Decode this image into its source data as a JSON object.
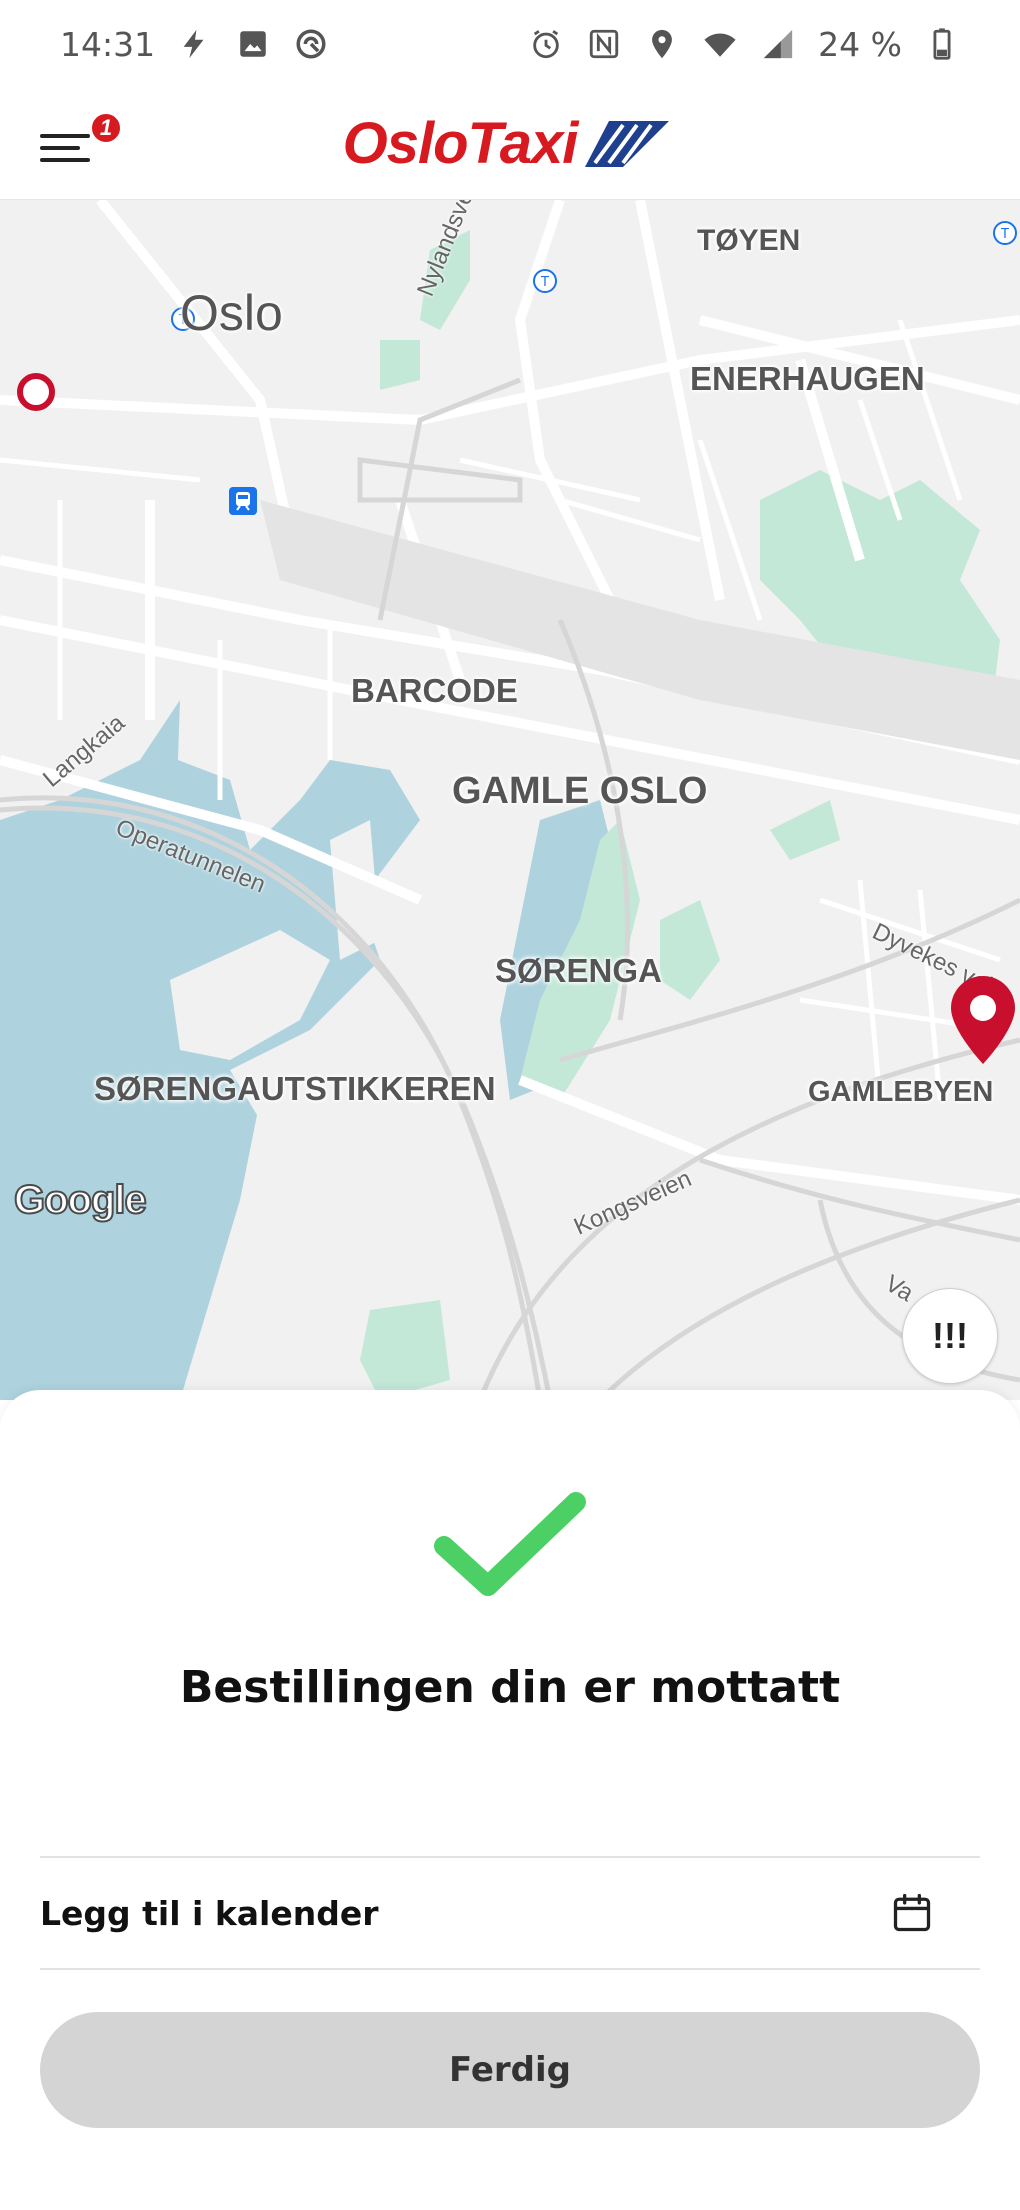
{
  "status_bar": {
    "time": "14:31",
    "left_icons": [
      "flash-icon",
      "image-icon",
      "sync-icon"
    ],
    "right_icons": [
      "alarm-icon",
      "nfc-icon",
      "location-icon",
      "wifi-icon",
      "signal-icon",
      "battery-icon"
    ],
    "battery": "24 %"
  },
  "header": {
    "menu_badge": "1",
    "logo_text": "OsloTaxi",
    "brand_color": "#d71920"
  },
  "map": {
    "city_label": "Oslo",
    "districts": [
      {
        "name": "TØYEN"
      },
      {
        "name": "ENERHAUGEN"
      },
      {
        "name": "BARCODE"
      },
      {
        "name": "GAMLE OSLO"
      },
      {
        "name": "SØRENGA"
      },
      {
        "name": "SØRENGAUTSTIKKEREN"
      },
      {
        "name": "GAMLEBYEN"
      }
    ],
    "streets": [
      {
        "name": "Nylandsveien"
      },
      {
        "name": "Langkaia"
      },
      {
        "name": "Operatunnelen"
      },
      {
        "name": "Dyvekes vei"
      },
      {
        "name": "Kongsveien"
      },
      {
        "name": "Va"
      }
    ],
    "attribution": "Google",
    "alert_button": "!!!",
    "colors": {
      "water": "#aed3de",
      "park": "#c3e8d8",
      "land": "#f1f1f1",
      "road": "#ffffff",
      "pin": "#c8102e"
    }
  },
  "confirmation": {
    "title": "Bestillingen din er mottatt",
    "check_color": "#4cd066",
    "calendar_label": "Legg til i kalender",
    "done_label": "Ferdig"
  }
}
